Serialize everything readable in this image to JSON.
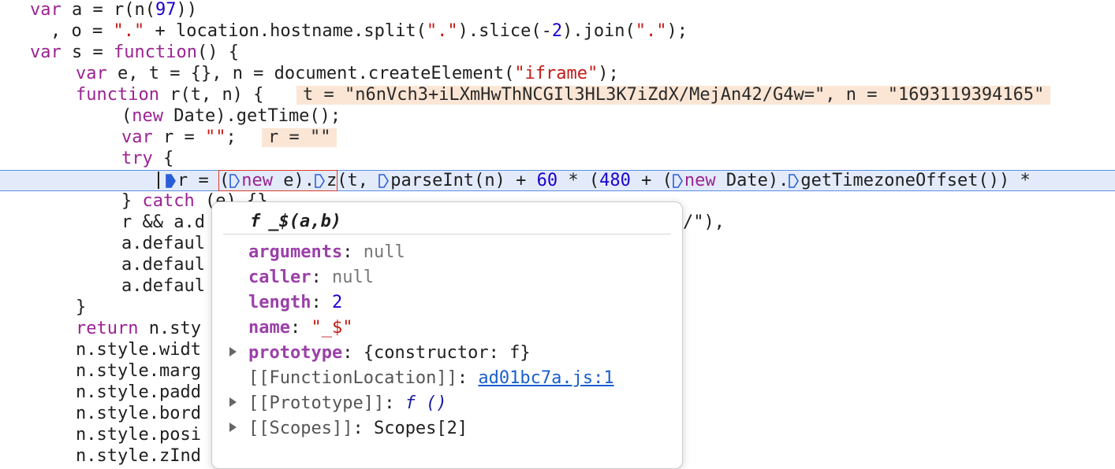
{
  "code_lines": [
    "  var a = r(n(97))",
    "    , o = \".\" + location.hostname.split(\".\").slice(-2).join(\".\");",
    "  var s = function() {",
    "      var e, t = {}, n = document.createElement(\"iframe\");",
    "      function r(t, n) {",
    "          (new Date).getTime();",
    "          var r = \"\";",
    "          try {",
    "r = (new e).z(t, parseInt(n) + 60 * (480 + (new Date).getTimezoneOffset()) *",
    "          } catch (e) {}",
    "          r && a.d",
    "          a.defaul",
    "          a.defaul",
    "          a.defaul",
    "      }",
    "      return n.sty",
    "      n.style.widt",
    "      n.style.marg",
    "      n.style.padd",
    "      n.style.bord",
    "      n.style.posi",
    "      n.style.zInd"
  ],
  "line10_tail": "/\"),",
  "inline_values": {
    "fn_params": "t = \"n6nVch3+iLXmHwThNCGIl3HL3K7iZdX/MejAn42/G4w=\", n = \"1693119394165\"",
    "r_value": "r = \"\""
  },
  "popover": {
    "f_glyph": "f",
    "title": "_$(a,b)",
    "props": [
      {
        "key": "arguments",
        "value": "null",
        "type": "null"
      },
      {
        "key": "caller",
        "value": "null",
        "type": "null"
      },
      {
        "key": "length",
        "value": "2",
        "type": "num"
      },
      {
        "key": "name",
        "value": "\"_$\"",
        "type": "str"
      },
      {
        "key": "prototype",
        "value": "{constructor: f}",
        "type": "obj"
      },
      {
        "key": "[[FunctionLocation]]",
        "value": "ad01bc7a.js:1",
        "type": "link"
      },
      {
        "key": "[[Prototype]]",
        "value": "f ()",
        "type": "fn"
      },
      {
        "key": "[[Scopes]]",
        "value": "Scopes[2]",
        "type": "obj"
      }
    ]
  },
  "colors": {
    "keyword": "#9b2393",
    "string": "#c41a16",
    "number": "#1c00cf",
    "highlight": "#e3ebfb",
    "inline_bg": "#fbe6d5"
  }
}
